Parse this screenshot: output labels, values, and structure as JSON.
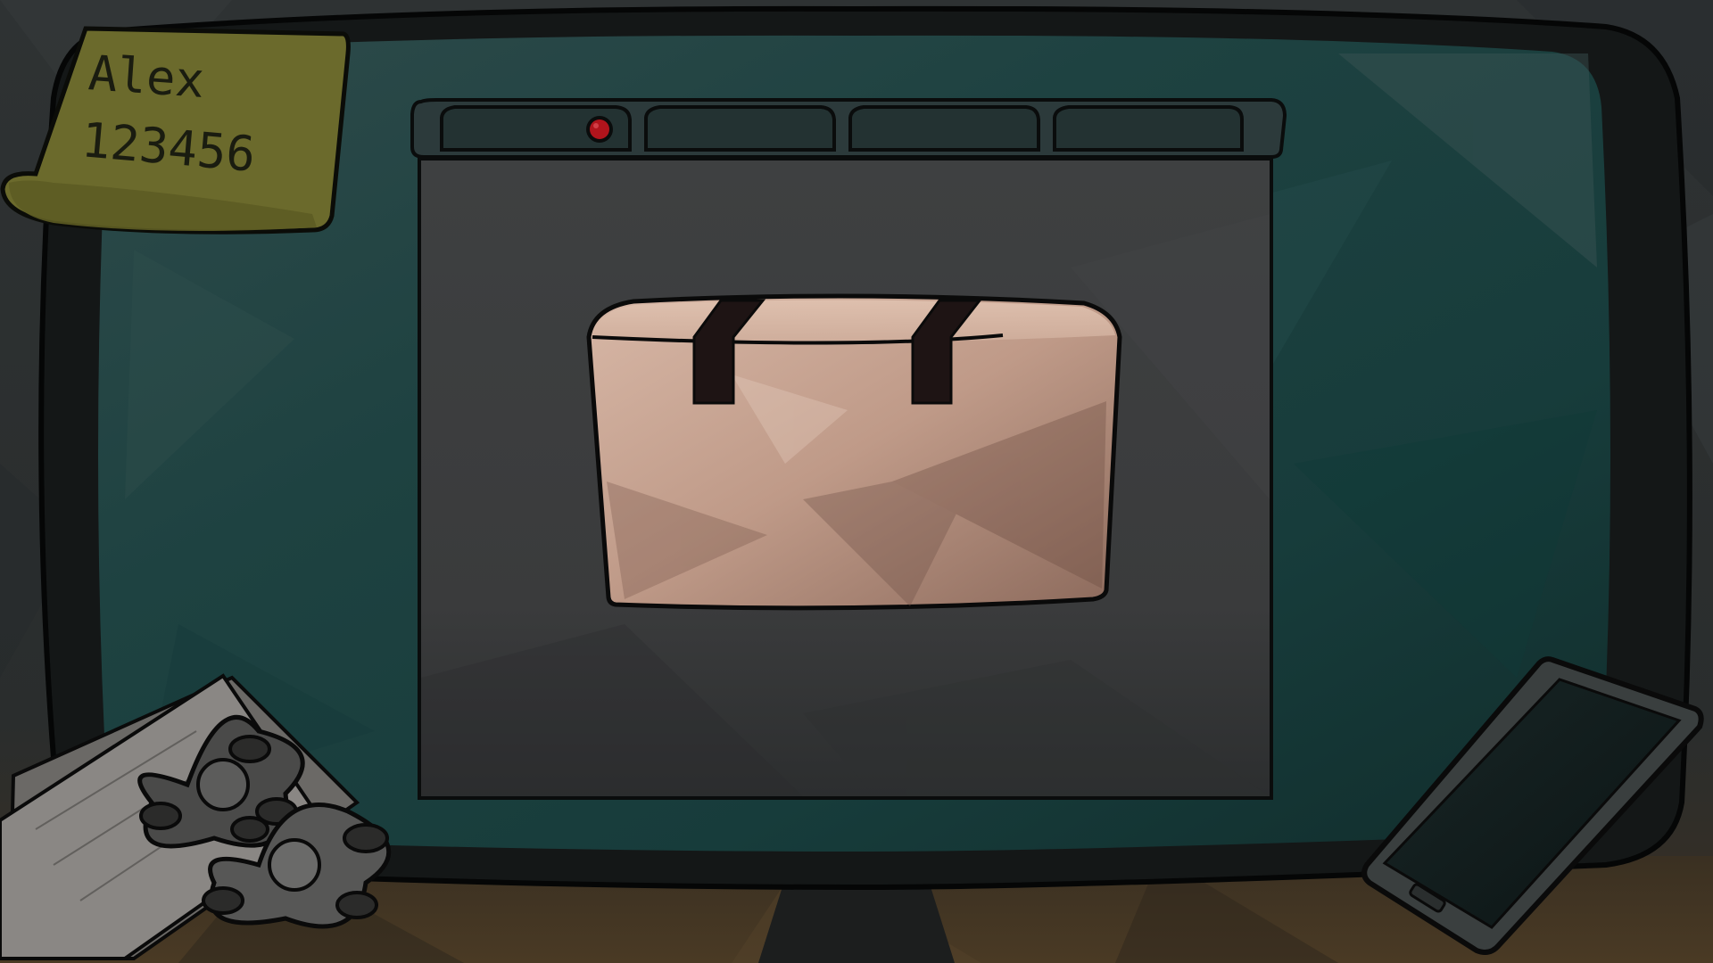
{
  "sticky_note": {
    "name": "Alex",
    "code": "123456"
  },
  "browser": {
    "tabs": [
      {
        "label": "",
        "has_record_dot": true
      },
      {
        "label": "",
        "has_record_dot": false
      },
      {
        "label": "",
        "has_record_dot": false
      },
      {
        "label": "",
        "has_record_dot": false
      }
    ]
  },
  "icons": {
    "record_dot": "record-dot-icon",
    "bread": "bread-loaf-icon",
    "spinner": "fidget-spinner-icon",
    "phone": "smartphone-icon"
  },
  "colors": {
    "monitor_bezel": "#151818",
    "screen_bg": "#1f4a48",
    "window_bg": "#3a3c3d",
    "note": "#6e6b2e",
    "bread": "#c9a595",
    "record_dot": "#b0141c"
  }
}
